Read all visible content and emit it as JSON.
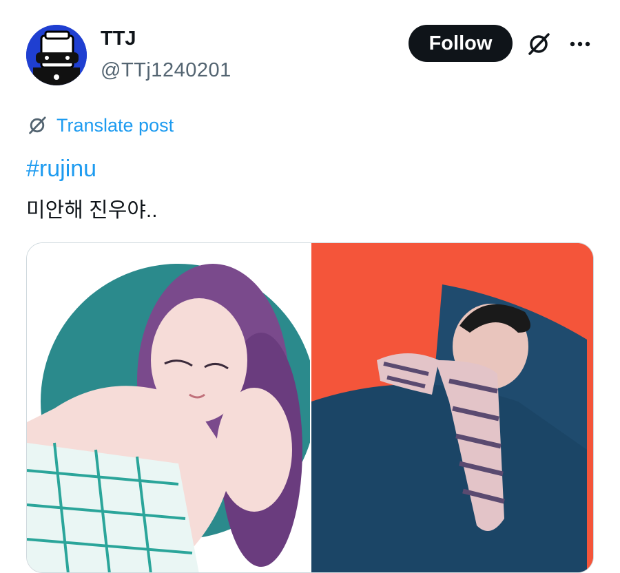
{
  "author": {
    "display_name": "TTJ",
    "handle": "@TTj1240201"
  },
  "actions": {
    "follow_label": "Follow",
    "grok_icon": "grok-slash-icon",
    "more_icon": "more-dots-icon"
  },
  "translate": {
    "label": "Translate post",
    "icon": "grok-slash-icon"
  },
  "post": {
    "hashtag": "#rujinu",
    "text": "미안해 진우야.."
  },
  "media": {
    "count": 2
  },
  "colors": {
    "link_blue": "#1d9bf0",
    "text_dark": "#0f1419",
    "text_muted": "#536471",
    "avatar_blue": "#1f3fd1",
    "right_image_bg": "#f4553a",
    "left_image_teal": "#2b8a8c"
  }
}
